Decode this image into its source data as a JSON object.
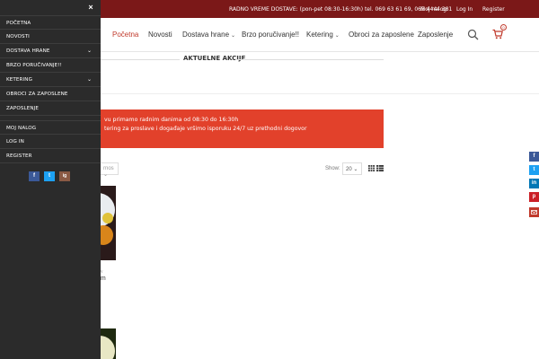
{
  "topbar": {
    "hours_text": "RADNO VREME DOSTAVE: (pon-pet 08:30-16:30h) tel. 069 63 61 69, 065 4444 381",
    "links": [
      "Moj nalog",
      "Log In",
      "Register"
    ]
  },
  "nav": {
    "items": [
      "Početna",
      "Novosti",
      "Dostava hrane",
      "Brzo poručivanje!!",
      "Ketering",
      "Obroci za zaposlene",
      "Zaposlenje"
    ],
    "active_index": 0,
    "cart_count": "0"
  },
  "section": {
    "title": "AKTUELNE AKCIJE"
  },
  "notice": {
    "line1": "vu primamo radnim danima od 08:30 do 16:30h",
    "line2": "tering za proslave i događaje vršimo isporuku 24/7 uz prethodni dogovor"
  },
  "toolbar": {
    "sort_value": "rnos",
    "show_label": "Show:",
    "show_value": "20"
  },
  "products": [
    {
      "category": "ow",
      "name": "om"
    }
  ],
  "sidemenu": {
    "close_symbol": "×",
    "items": [
      {
        "label": "POČETNA",
        "has_arrow": false
      },
      {
        "label": "NOVOSTI",
        "has_arrow": false
      },
      {
        "label": "DOSTAVA HRANE",
        "has_arrow": true
      },
      {
        "label": "BRZO PORUČIVANJE!!",
        "has_arrow": false
      },
      {
        "label": "KETERING",
        "has_arrow": true
      },
      {
        "label": "OBROCI ZA ZAPOSLENE",
        "has_arrow": false
      },
      {
        "label": "ZAPOSLENJE",
        "has_arrow": false
      },
      {
        "label": "MOJ NALOG",
        "has_arrow": false
      },
      {
        "label": "LOG IN",
        "has_arrow": false
      },
      {
        "label": "REGISTER",
        "has_arrow": false
      }
    ],
    "social": [
      "f",
      "t",
      "ig"
    ]
  },
  "share_icons": [
    "f",
    "t",
    "in",
    "p",
    "mail"
  ],
  "colors": {
    "topbar": "#7b1818",
    "accent": "#c0392b",
    "notice": "#e2412b",
    "sidemenu": "#2b2b2b",
    "facebook": "#3b5998",
    "twitter": "#1da1f2",
    "instagram": "#8a5a44",
    "linkedin": "#0077b5",
    "pinterest": "#cb2027",
    "mail": "#c0392b"
  }
}
